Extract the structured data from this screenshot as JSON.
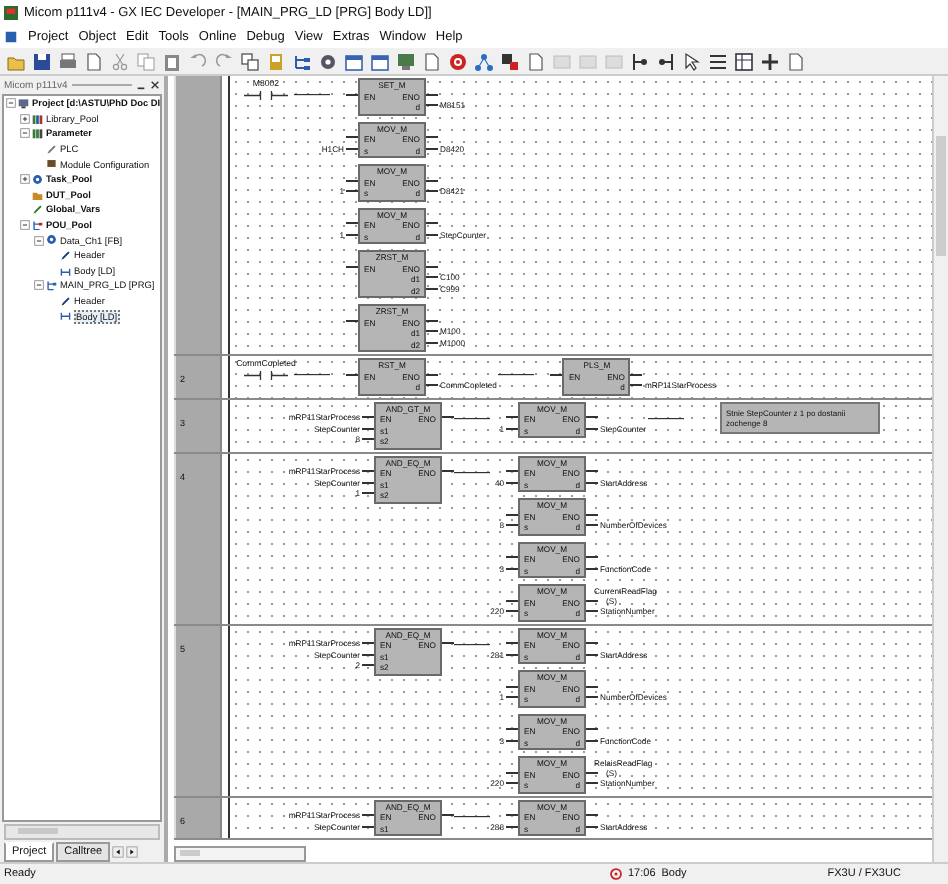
{
  "window": {
    "title": "Micom p111v4 - GX IEC Developer - [MAIN_PRG_LD [PRG] Body LD]]"
  },
  "menu": [
    "Project",
    "Object",
    "Edit",
    "Tools",
    "Online",
    "Debug",
    "View",
    "Extras",
    "Window",
    "Help"
  ],
  "project_panel": {
    "title": "Micom p111v4",
    "tree": {
      "label": "Project [d:\\ASTU\\PhD Doc DI",
      "kind": "project",
      "bold": true,
      "selected": false,
      "expanded": true,
      "children": [
        {
          "label": "Library_Pool",
          "kind": "library",
          "bold": false,
          "selected": false,
          "expanded": false
        },
        {
          "label": "Parameter",
          "kind": "parameter",
          "bold": true,
          "selected": false,
          "expanded": true,
          "children": [
            {
              "label": "PLC",
              "kind": "plc",
              "bold": false,
              "selected": false
            },
            {
              "label": "Module Configuration",
              "kind": "module",
              "bold": false,
              "selected": false
            }
          ]
        },
        {
          "label": "Task_Pool",
          "kind": "task",
          "bold": true,
          "selected": false,
          "expanded": false
        },
        {
          "label": "DUT_Pool",
          "kind": "dut",
          "bold": true,
          "selected": false
        },
        {
          "label": "Global_Vars",
          "kind": "global",
          "bold": true,
          "selected": false
        },
        {
          "label": "POU_Pool",
          "kind": "pou",
          "bold": true,
          "selected": false,
          "expanded": true,
          "children": [
            {
              "label": "Data_Ch1 [FB]",
              "kind": "fb",
              "bold": false,
              "selected": false,
              "expanded": true,
              "children": [
                {
                  "label": "Header",
                  "kind": "header",
                  "bold": false,
                  "selected": false
                },
                {
                  "label": "Body [LD]",
                  "kind": "body",
                  "bold": false,
                  "selected": false
                }
              ]
            },
            {
              "label": "MAIN_PRG_LD [PRG]",
              "kind": "prg",
              "bold": false,
              "selected": false,
              "expanded": true,
              "children": [
                {
                  "label": "Header",
                  "kind": "header",
                  "bold": false,
                  "selected": false
                },
                {
                  "label": "Body [LD]",
                  "kind": "body",
                  "bold": false,
                  "selected": true
                }
              ]
            }
          ]
        }
      ]
    },
    "tabs": [
      {
        "label": "Project",
        "selected": true
      },
      {
        "label": "Calltree",
        "selected": false
      }
    ]
  },
  "editor": {
    "networks": [
      {
        "stages": [
          {
            "kind": "contact",
            "label": "M8002"
          },
          {
            "kind": "blocks",
            "blocks": [
              {
                "name": "SET_M",
                "inputs": [
                  {
                    "pin": "EN"
                  }
                ],
                "outputs": [
                  {
                    "pin": "ENO"
                  },
                  {
                    "pin": "d",
                    "value": "M8151"
                  }
                ]
              },
              {
                "name": "MOV_M",
                "inputs": [
                  {
                    "pin": "EN"
                  },
                  {
                    "pin": "s",
                    "value": "H1CH"
                  }
                ],
                "outputs": [
                  {
                    "pin": "ENO"
                  },
                  {
                    "pin": "d",
                    "value": "D8420"
                  }
                ]
              },
              {
                "name": "MOV_M",
                "inputs": [
                  {
                    "pin": "EN"
                  },
                  {
                    "pin": "s",
                    "value": "1"
                  }
                ],
                "outputs": [
                  {
                    "pin": "ENO"
                  },
                  {
                    "pin": "d",
                    "value": "D8421"
                  }
                ]
              },
              {
                "name": "MOV_M",
                "inputs": [
                  {
                    "pin": "EN"
                  },
                  {
                    "pin": "s",
                    "value": "1"
                  }
                ],
                "outputs": [
                  {
                    "pin": "ENO"
                  },
                  {
                    "pin": "d",
                    "value": "StepCounter"
                  }
                ]
              },
              {
                "name": "ZRST_M",
                "inputs": [
                  {
                    "pin": "EN"
                  }
                ],
                "outputs": [
                  {
                    "pin": "ENO"
                  },
                  {
                    "pin": "d1",
                    "value": "C100"
                  },
                  {
                    "pin": "d2",
                    "value": "C999"
                  }
                ]
              },
              {
                "name": "ZRST_M",
                "inputs": [
                  {
                    "pin": "EN"
                  }
                ],
                "outputs": [
                  {
                    "pin": "ENO"
                  },
                  {
                    "pin": "d1",
                    "value": "M100"
                  },
                  {
                    "pin": "d2",
                    "value": "M1000"
                  }
                ]
              }
            ]
          }
        ]
      },
      {
        "number": "2",
        "stages": [
          {
            "kind": "contact",
            "label": "CommCopleted"
          },
          {
            "kind": "blocks",
            "blocks": [
              {
                "name": "RST_M",
                "inputs": [
                  {
                    "pin": "EN"
                  }
                ],
                "outputs": [
                  {
                    "pin": "ENO"
                  },
                  {
                    "pin": "d",
                    "value": "CommCopleted"
                  }
                ]
              }
            ]
          },
          {
            "kind": "blocks",
            "blocks": [
              {
                "name": "PLS_M",
                "inputs": [
                  {
                    "pin": "EN"
                  }
                ],
                "outputs": [
                  {
                    "pin": "ENO"
                  },
                  {
                    "pin": "d",
                    "value": "mRP11StarProcess"
                  }
                ]
              }
            ]
          }
        ]
      },
      {
        "number": "3",
        "stages": [
          {
            "kind": "blocks",
            "blocks": [
              {
                "name": "AND_GT_M",
                "inputs": [
                  {
                    "pin": "EN",
                    "value": "mRP11StarProcess"
                  },
                  {
                    "pin": "s1",
                    "value": "StepCounter"
                  },
                  {
                    "pin": "s2",
                    "value": "8"
                  }
                ],
                "outputs": [
                  {
                    "pin": "ENO"
                  }
                ]
              }
            ]
          },
          {
            "kind": "blocks",
            "blocks": [
              {
                "name": "MOV_M",
                "inputs": [
                  {
                    "pin": "EN"
                  },
                  {
                    "pin": "s",
                    "value": "1"
                  }
                ],
                "outputs": [
                  {
                    "pin": "ENO"
                  },
                  {
                    "pin": "d",
                    "value": "StepCounter"
                  }
                ]
              }
            ]
          },
          {
            "kind": "comment",
            "text": "Stnie StepCounter z 1 po dostanii zochenge 8"
          }
        ]
      },
      {
        "number": "4",
        "stages": [
          {
            "kind": "blocks",
            "blocks": [
              {
                "name": "AND_EQ_M",
                "inputs": [
                  {
                    "pin": "EN",
                    "value": "mRP11StarProcess"
                  },
                  {
                    "pin": "s1",
                    "value": "StepCounter"
                  },
                  {
                    "pin": "s2",
                    "value": "1"
                  }
                ],
                "outputs": [
                  {
                    "pin": "ENO"
                  }
                ]
              }
            ]
          },
          {
            "kind": "blocks",
            "blocks": [
              {
                "name": "MOV_M",
                "inputs": [
                  {
                    "pin": "EN"
                  },
                  {
                    "pin": "s",
                    "value": "40"
                  }
                ],
                "outputs": [
                  {
                    "pin": "ENO"
                  },
                  {
                    "pin": "d",
                    "value": "StartAddress"
                  }
                ]
              },
              {
                "name": "MOV_M",
                "inputs": [
                  {
                    "pin": "EN"
                  },
                  {
                    "pin": "s",
                    "value": "8"
                  }
                ],
                "outputs": [
                  {
                    "pin": "ENO"
                  },
                  {
                    "pin": "d",
                    "value": "NumberOfDevices"
                  }
                ]
              },
              {
                "name": "MOV_M",
                "inputs": [
                  {
                    "pin": "EN"
                  },
                  {
                    "pin": "s",
                    "value": "3"
                  }
                ],
                "outputs": [
                  {
                    "pin": "ENO"
                  },
                  {
                    "pin": "d",
                    "value": "FunctionCode"
                  }
                ]
              },
              {
                "name": "MOV_M",
                "inputs": [
                  {
                    "pin": "EN"
                  },
                  {
                    "pin": "s",
                    "value": "220"
                  }
                ],
                "outputs": [
                  {
                    "pin": "ENO",
                    "coil": "CurrentReadFlag",
                    "coil_symbol": "(S)"
                  },
                  {
                    "pin": "d",
                    "value": "StationNumber"
                  }
                ]
              }
            ]
          }
        ]
      },
      {
        "number": "5",
        "stages": [
          {
            "kind": "blocks",
            "blocks": [
              {
                "name": "AND_EQ_M",
                "inputs": [
                  {
                    "pin": "EN",
                    "value": "mRP11StarProcess"
                  },
                  {
                    "pin": "s1",
                    "value": "StepCounter"
                  },
                  {
                    "pin": "s2",
                    "value": "2"
                  }
                ],
                "outputs": [
                  {
                    "pin": "ENO"
                  }
                ]
              }
            ]
          },
          {
            "kind": "blocks",
            "blocks": [
              {
                "name": "MOV_M",
                "inputs": [
                  {
                    "pin": "EN"
                  },
                  {
                    "pin": "s",
                    "value": "281"
                  }
                ],
                "outputs": [
                  {
                    "pin": "ENO"
                  },
                  {
                    "pin": "d",
                    "value": "StartAddress"
                  }
                ]
              },
              {
                "name": "MOV_M",
                "inputs": [
                  {
                    "pin": "EN"
                  },
                  {
                    "pin": "s",
                    "value": "1"
                  }
                ],
                "outputs": [
                  {
                    "pin": "ENO"
                  },
                  {
                    "pin": "d",
                    "value": "NumberOfDevices"
                  }
                ]
              },
              {
                "name": "MOV_M",
                "inputs": [
                  {
                    "pin": "EN"
                  },
                  {
                    "pin": "s",
                    "value": "3"
                  }
                ],
                "outputs": [
                  {
                    "pin": "ENO"
                  },
                  {
                    "pin": "d",
                    "value": "FunctionCode"
                  }
                ]
              },
              {
                "name": "MOV_M",
                "inputs": [
                  {
                    "pin": "EN"
                  },
                  {
                    "pin": "s",
                    "value": "220"
                  }
                ],
                "outputs": [
                  {
                    "pin": "ENO",
                    "coil": "RelaisReadFlag",
                    "coil_symbol": "(S)"
                  },
                  {
                    "pin": "d",
                    "value": "StationNumber"
                  }
                ]
              }
            ]
          }
        ]
      },
      {
        "number": "6",
        "stages": [
          {
            "kind": "blocks",
            "blocks": [
              {
                "name": "AND_EQ_M",
                "inputs": [
                  {
                    "pin": "EN",
                    "value": "mRP11StarProcess"
                  },
                  {
                    "pin": "s1",
                    "value": "StepCounter"
                  }
                ],
                "outputs": [
                  {
                    "pin": "ENO"
                  }
                ]
              }
            ]
          },
          {
            "kind": "blocks",
            "blocks": [
              {
                "name": "MOV_M",
                "inputs": [
                  {
                    "pin": "EN"
                  },
                  {
                    "pin": "s",
                    "value": "288"
                  }
                ],
                "outputs": [
                  {
                    "pin": "ENO"
                  },
                  {
                    "pin": "d",
                    "value": "StartAddress"
                  }
                ]
              }
            ]
          }
        ]
      }
    ]
  },
  "status_bar": {
    "message": "Ready",
    "time": "17:06",
    "mode": "Body",
    "plc": "FX3U / FX3UC"
  }
}
